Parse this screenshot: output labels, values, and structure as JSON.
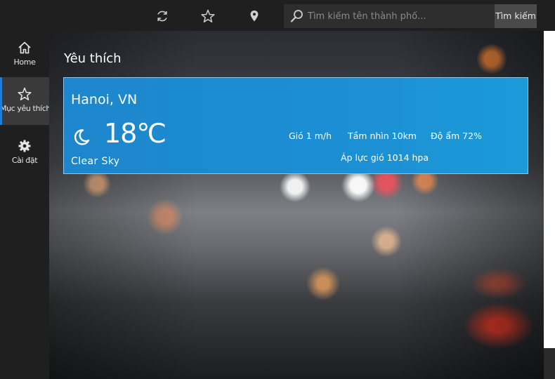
{
  "topbar": {
    "refresh_icon": "refresh-icon",
    "favorite_icon": "star-icon",
    "location_icon": "location-pin-icon",
    "search": {
      "placeholder": "Tìm kiếm tên thành phố...",
      "value": "",
      "icon": "search-icon"
    },
    "search_button_label": "Tìm kiếm"
  },
  "sidebar": {
    "items": [
      {
        "label": "Home",
        "icon": "home-icon",
        "active": false
      },
      {
        "label": "Mục yêu thích",
        "icon": "star-icon",
        "active": true
      },
      {
        "label": "Cài đặt",
        "icon": "gear-icon",
        "active": false
      }
    ],
    "accent_color": "#1e7fd6"
  },
  "main": {
    "title": "Yêu thích",
    "favorites": [
      {
        "city": "Hanoi, VN",
        "temperature": "18℃",
        "condition": "Clear Sky",
        "condition_icon": "moon-cloud-icon",
        "wind": "Gió 1 m/h",
        "visibility": "Tầm nhìn 10km",
        "humidity": "Độ ẩm 72%",
        "pressure": "Áp lực gió 1014 hpa",
        "card_color": "#1c8fd4"
      }
    ]
  }
}
